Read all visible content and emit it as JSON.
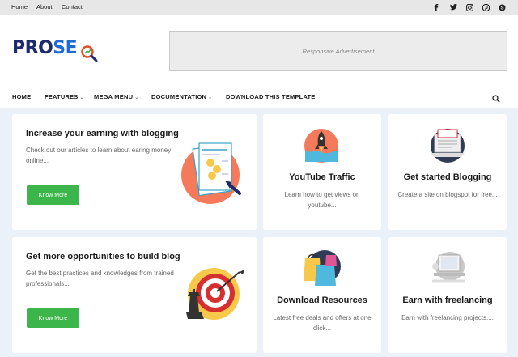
{
  "topnav": {
    "home": "Home",
    "about": "About",
    "contact": "Contact"
  },
  "social_icons": [
    "facebook-icon",
    "twitter-icon",
    "instagram-icon",
    "pinterest-icon",
    "skype-icon"
  ],
  "logo": {
    "part1": "PRO",
    "part2": "SE",
    "part3": "O"
  },
  "ad": {
    "text": "Responsive Advertisement"
  },
  "menu": {
    "home": "HOME",
    "features": "FEATURES",
    "mega_menu": "MEGA MENU",
    "documentation": "DOCUMENTATION",
    "download": "DOWNLOAD THIS TEMPLATE"
  },
  "cards": {
    "blogging": {
      "title": "Increase your earning with blogging",
      "desc": "Check out our articles to learn about earing money online...",
      "button": "Know More"
    },
    "opportunities": {
      "title": "Get more opportunities to build blog",
      "desc": "Get the best practices and knowledges from trained professionals...",
      "button": "Know More"
    },
    "youtube": {
      "title": "YouTube Traffic",
      "desc": "Learn how to get views on youtube..."
    },
    "started": {
      "title": "Get started Blogging",
      "desc": "Create a site on blogspot for free..."
    },
    "resources": {
      "title": "Download Resources",
      "desc": "Latest free deals and offers at one click..."
    },
    "freelancing": {
      "title": "Earn with freelancing",
      "desc": "Earn with freelancing projects...."
    }
  },
  "colors": {
    "accent_green": "#3cb54a",
    "logo_navy": "#1d2a6b",
    "logo_blue": "#1d6cd6",
    "logo_orange": "#e44d26",
    "page_bg": "#eaf1f8"
  }
}
